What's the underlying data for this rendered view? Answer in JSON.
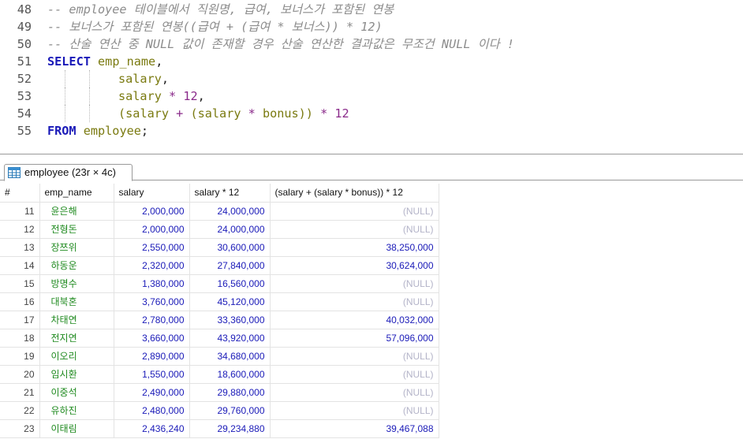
{
  "editor": {
    "lines": [
      {
        "num": "48",
        "indent": 0,
        "tokens": [
          {
            "t": "-- employee 테이블에서 직원명, 급여, 보너스가 포함된 연봉",
            "c": "cmt"
          }
        ]
      },
      {
        "num": "49",
        "indent": 0,
        "tokens": [
          {
            "t": "-- 보너스가 포함된 연봉((급여 + (급여 * 보너스)) * 12)",
            "c": "cmt"
          }
        ]
      },
      {
        "num": "50",
        "indent": 0,
        "tokens": [
          {
            "t": "-- 산술 연산 중 NULL 값이 존재할 경우 산술 연산한 결과값은 무조건 NULL 이다 !",
            "c": "cmt"
          }
        ]
      },
      {
        "num": "51",
        "indent": 0,
        "tokens": [
          {
            "t": "SELECT",
            "c": "kw"
          },
          {
            "t": " ",
            "c": "pn"
          },
          {
            "t": "emp_name",
            "c": "id"
          },
          {
            "t": ",",
            "c": "pn"
          }
        ]
      },
      {
        "num": "52",
        "indent": 1,
        "tokens": [
          {
            "t": "salary",
            "c": "id"
          },
          {
            "t": ",",
            "c": "pn"
          }
        ]
      },
      {
        "num": "53",
        "indent": 1,
        "tokens": [
          {
            "t": "salary",
            "c": "id"
          },
          {
            "t": " * ",
            "c": "op"
          },
          {
            "t": "12",
            "c": "num"
          },
          {
            "t": ",",
            "c": "pn"
          }
        ]
      },
      {
        "num": "54",
        "indent": 1,
        "tokens": [
          {
            "t": "(",
            "c": "id"
          },
          {
            "t": "salary",
            "c": "id"
          },
          {
            "t": " + ",
            "c": "op"
          },
          {
            "t": "(",
            "c": "id"
          },
          {
            "t": "salary",
            "c": "id"
          },
          {
            "t": " * ",
            "c": "op"
          },
          {
            "t": "bonus",
            "c": "id"
          },
          {
            "t": "))",
            "c": "id"
          },
          {
            "t": " * ",
            "c": "op"
          },
          {
            "t": "12",
            "c": "num"
          }
        ]
      },
      {
        "num": "55",
        "indent": 0,
        "tokens": [
          {
            "t": "FROM",
            "c": "kw"
          },
          {
            "t": " ",
            "c": "pn"
          },
          {
            "t": "employee",
            "c": "id"
          },
          {
            "t": ";",
            "c": "pn"
          }
        ]
      }
    ]
  },
  "result": {
    "tab_label": "employee (23r × 4c)",
    "columns": [
      "#",
      "emp_name",
      "salary",
      "salary * 12",
      "(salary + (salary * bonus)) * 12"
    ],
    "rows": [
      [
        "11",
        "윤은해",
        "2,000,000",
        "24,000,000",
        "(NULL)"
      ],
      [
        "12",
        "전형돈",
        "2,000,000",
        "24,000,000",
        "(NULL)"
      ],
      [
        "13",
        "장쯔위",
        "2,550,000",
        "30,600,000",
        "38,250,000"
      ],
      [
        "14",
        "하동운",
        "2,320,000",
        "27,840,000",
        "30,624,000"
      ],
      [
        "15",
        "방명수",
        "1,380,000",
        "16,560,000",
        "(NULL)"
      ],
      [
        "16",
        "대북혼",
        "3,760,000",
        "45,120,000",
        "(NULL)"
      ],
      [
        "17",
        "차태연",
        "2,780,000",
        "33,360,000",
        "40,032,000"
      ],
      [
        "18",
        "전지연",
        "3,660,000",
        "43,920,000",
        "57,096,000"
      ],
      [
        "19",
        "이오리",
        "2,890,000",
        "34,680,000",
        "(NULL)"
      ],
      [
        "20",
        "임시환",
        "1,550,000",
        "18,600,000",
        "(NULL)"
      ],
      [
        "21",
        "이중석",
        "2,490,000",
        "29,880,000",
        "(NULL)"
      ],
      [
        "22",
        "유하진",
        "2,480,000",
        "29,760,000",
        "(NULL)"
      ],
      [
        "23",
        "이태림",
        "2,436,240",
        "29,234,880",
        "39,467,088"
      ]
    ]
  },
  "colors": {
    "keyword": "#1a1ab8",
    "identifier": "#7a7a10",
    "number": "#8a2a8a",
    "comment": "#8c8c8c",
    "name_text": "#1f8a1f",
    "money_text": "#1a1ab8",
    "null_text": "#b3b3c8"
  },
  "icons": {
    "tab": "table-grid-icon"
  }
}
